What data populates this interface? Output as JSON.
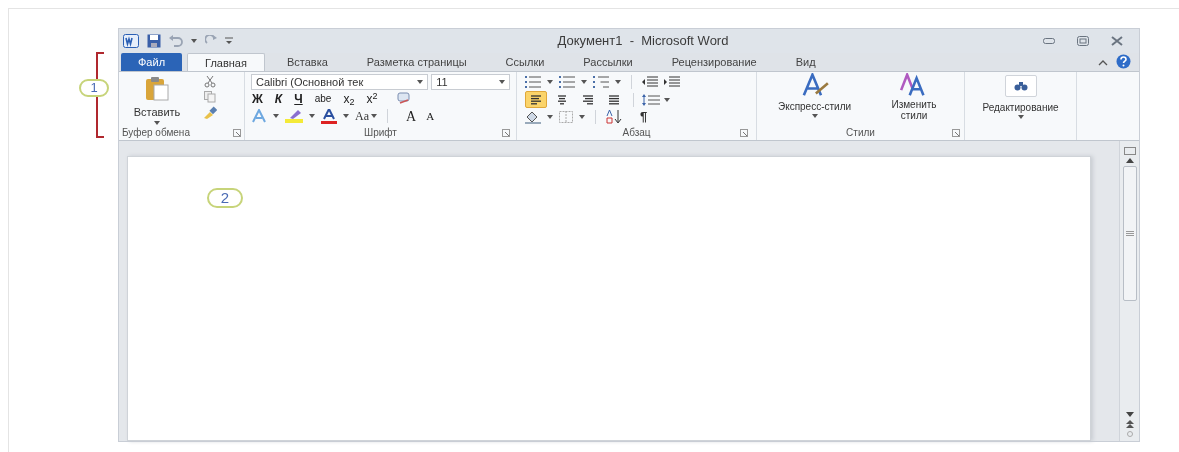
{
  "window": {
    "title": "Документ1  -  Microsoft Word"
  },
  "tabs": [
    {
      "label": "Файл",
      "kind": "file",
      "selected": false
    },
    {
      "label": "Главная",
      "kind": "tab",
      "selected": true
    },
    {
      "label": "Вставка",
      "kind": "tab",
      "selected": false
    },
    {
      "label": "Разметка страницы",
      "kind": "tab",
      "selected": false
    },
    {
      "label": "Ссылки",
      "kind": "tab",
      "selected": false
    },
    {
      "label": "Рассылки",
      "kind": "tab",
      "selected": false
    },
    {
      "label": "Рецензирование",
      "kind": "tab",
      "selected": false
    },
    {
      "label": "Вид",
      "kind": "tab",
      "selected": false
    }
  ],
  "clipboard": {
    "paste": "Вставить",
    "label": "Буфер обмена"
  },
  "font": {
    "name": "Calibri (Основной тек",
    "size": "11",
    "format": [
      "Ж",
      "К",
      "Ч",
      "abe",
      "x$_{2}$",
      "x$^{2}$"
    ],
    "case": "Aa",
    "grow": "A",
    "shrink": "A",
    "label": "Шрифт"
  },
  "paragraph": {
    "align": [
      {
        "selected": true
      },
      {
        "selected": false
      },
      {
        "selected": false
      },
      {
        "selected": false
      }
    ],
    "marks": "¶",
    "label": "Абзац"
  },
  "styles": {
    "quick": "Экспресс-стили",
    "change": "Изменить стили",
    "label": "Стили"
  },
  "editing": {
    "label": "Редактирование"
  },
  "callouts": [
    "1",
    "2"
  ]
}
